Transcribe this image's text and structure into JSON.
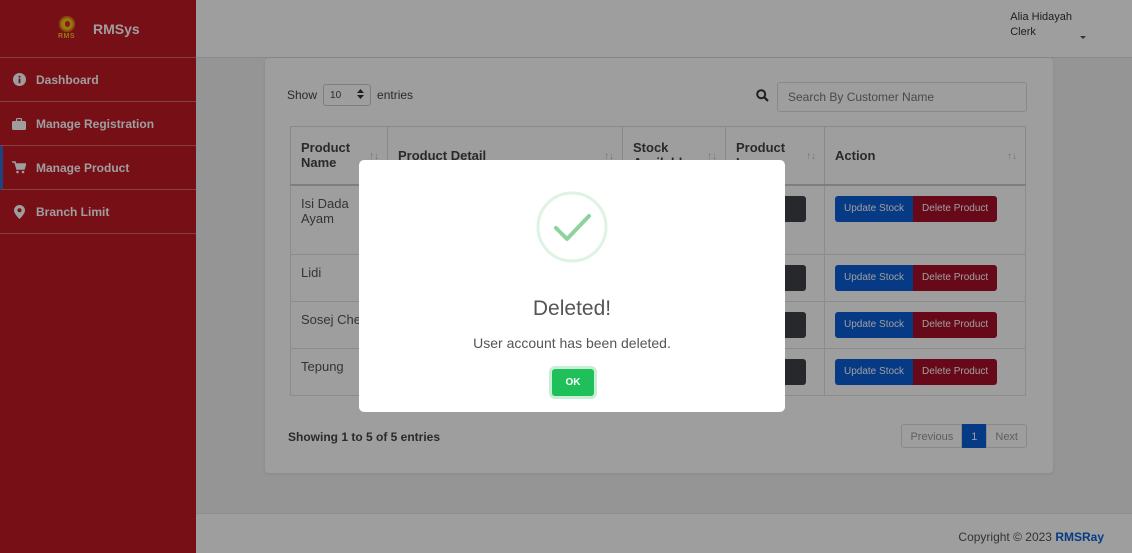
{
  "app": {
    "brand_name": "RMSys",
    "logo_text": "RMS"
  },
  "sidebar": {
    "items": [
      {
        "label": "Dashboard",
        "icon": "info-icon"
      },
      {
        "label": "Manage Registration",
        "icon": "briefcase-icon"
      },
      {
        "label": "Manage Product",
        "icon": "cart-icon",
        "active": true
      },
      {
        "label": "Branch Limit",
        "icon": "map-pin-icon"
      }
    ]
  },
  "topbar": {
    "user_name": "Alia Hidayah",
    "user_role": "Clerk"
  },
  "table_controls": {
    "show_label": "Show",
    "show_value": "10",
    "entries_label": "entries",
    "search_placeholder": "Search By Customer Name"
  },
  "table": {
    "headers": [
      "Product Name",
      "Product Detail",
      "Stock Available",
      "Product Image",
      "Action"
    ],
    "rows": [
      {
        "name": "Isi Dada Ayam"
      },
      {
        "name": "Lidi"
      },
      {
        "name": "Sosej Che"
      },
      {
        "name": "Tepung"
      }
    ],
    "update_label": "Update Stock",
    "delete_label": "Delete Product"
  },
  "info_text": "Showing 1 to 5 of 5 entries",
  "pagination": {
    "previous": "Previous",
    "current": "1",
    "next": "Next"
  },
  "footer": {
    "text": "Copyright © 2023",
    "brand": "RMSRay"
  },
  "modal": {
    "title": "Deleted!",
    "message": "User account has been deleted.",
    "ok_label": "OK"
  },
  "colors": {
    "sidebar": "#c01a24",
    "primary": "#0b5ed7",
    "danger": "#a8102a",
    "success": "#1fbf5a"
  }
}
